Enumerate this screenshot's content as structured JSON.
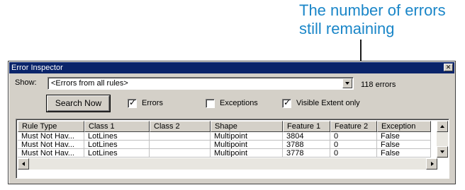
{
  "callout": {
    "line1": "The number of errors",
    "line2": "still remaining"
  },
  "window": {
    "title": "Error Inspector",
    "close_glyph": "✕"
  },
  "show": {
    "label": "Show:",
    "selected": "<Errors from all rules>",
    "error_count": "118 errors"
  },
  "actions": {
    "search_now": "Search Now"
  },
  "filters": [
    {
      "label": "Errors",
      "checked": true
    },
    {
      "label": "Exceptions",
      "checked": false
    },
    {
      "label": "Visible Extent only",
      "checked": true
    }
  ],
  "table": {
    "columns": [
      "Rule Type",
      "Class 1",
      "Class 2",
      "Shape",
      "Feature 1",
      "Feature 2",
      "Exception"
    ],
    "rows": [
      [
        "Must Not Hav...",
        "LotLines",
        "",
        "Multipoint",
        "3804",
        "0",
        "False"
      ],
      [
        "Must Not Hav...",
        "LotLines",
        "",
        "Multipoint",
        "3788",
        "0",
        "False"
      ],
      [
        "Must Not Hav...",
        "LotLines",
        "",
        "Multipoint",
        "3778",
        "0",
        "False"
      ]
    ]
  },
  "colors": {
    "callout": "#1a86c8",
    "titlebar": "#0a246a",
    "face": "#d4d0c8"
  },
  "icons": {
    "close": "close-icon",
    "dropdown": "chevron-down-icon",
    "scroll_up": "scroll-up-icon",
    "scroll_down": "scroll-down-icon",
    "scroll_left": "scroll-left-icon",
    "scroll_right": "scroll-right-icon"
  }
}
